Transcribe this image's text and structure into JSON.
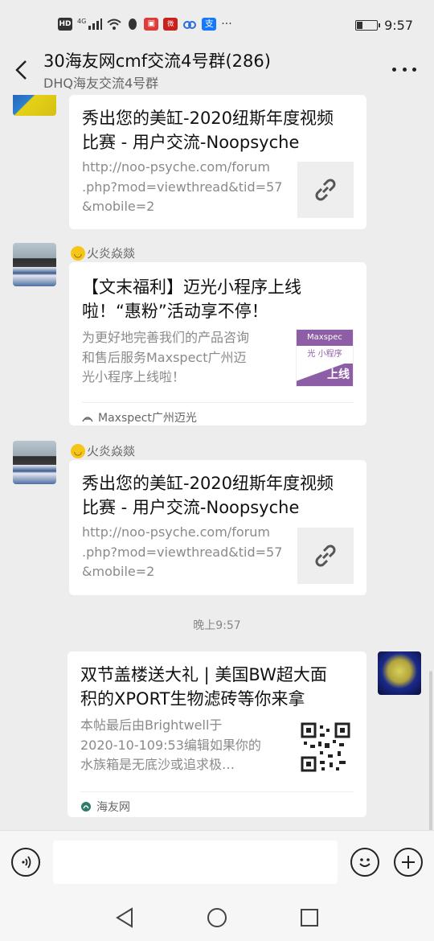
{
  "status": {
    "time": "9:57",
    "network": "4G",
    "badges": [
      "HD",
      "QQ",
      "weibo",
      "baidu",
      "alipay"
    ]
  },
  "header": {
    "title": "30海友网cmf交流4号群(286)",
    "subtitle": "DHQ海友交流4号群"
  },
  "messages": [
    {
      "title_lines": [
        "秀出您的美缸-2020纽斯年度视频",
        "比赛 - 用户交流-Noopsyche"
      ],
      "desc_lines": [
        "http://noo-psyche.com/forum",
        ".php?mod=viewthread&tid=57",
        "&mobile=2"
      ],
      "thumb": "link-icon"
    },
    {
      "nickname": "火炎焱燚",
      "title_lines": [
        "【文末福利】迈光小程序上线",
        "啦！“惠粉”活动享不停！"
      ],
      "desc_lines": [
        "为更好地完善我们的产品咨询",
        "和售后服务Maxspect广州迈",
        "光小程序上线啦！"
      ],
      "thumb_text": {
        "top": "Maxspec",
        "mid": "光 小程序",
        "bottom": "上线"
      },
      "source": "Maxspect广州迈光"
    },
    {
      "nickname": "火炎焱燚",
      "title_lines": [
        "秀出您的美缸-2020纽斯年度视频",
        "比赛 - 用户交流-Noopsyche"
      ],
      "desc_lines": [
        "http://noo-psyche.com/forum",
        ".php?mod=viewthread&tid=57",
        "&mobile=2"
      ],
      "thumb": "link-icon"
    },
    {
      "title_lines": [
        "双节盖楼送大礼 | 美国BW超大面",
        "积的XPORT生物滤砖等你来拿"
      ],
      "desc_lines": [
        "本帖最后由Brightwell于",
        "2020-10-109:53编辑如果你的",
        "水族箱是无底沙或追求极…"
      ],
      "thumb": "qr-code",
      "source": "海友网"
    }
  ],
  "timestamp": "晚上9:57",
  "colors": {
    "background": "#ededed",
    "card": "#ffffff",
    "secondary_text": "#8a8a8a"
  }
}
